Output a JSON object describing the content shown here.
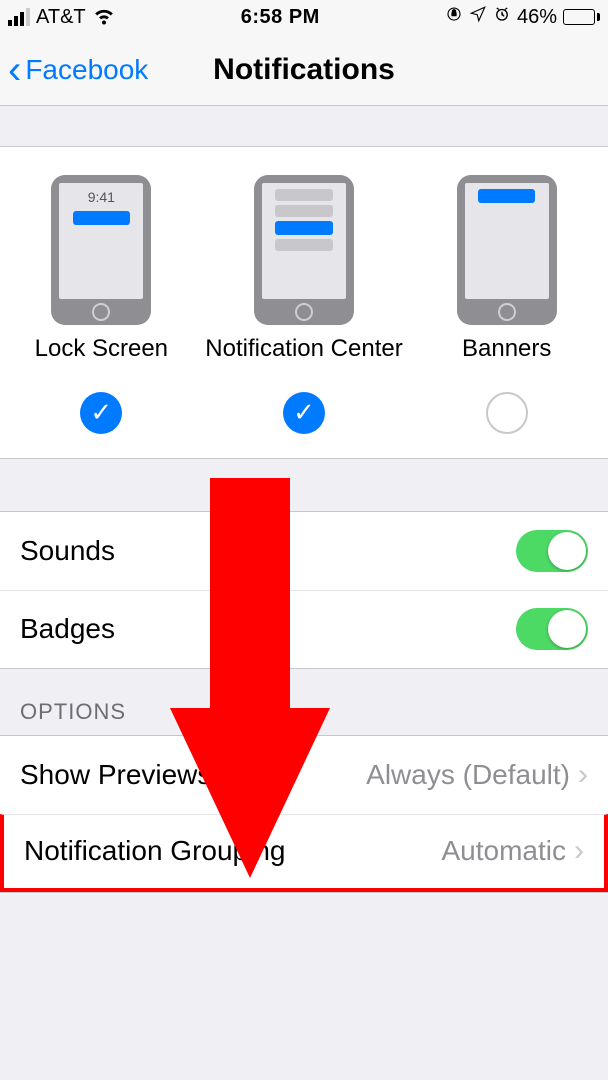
{
  "status": {
    "carrier": "AT&T",
    "time": "6:58 PM",
    "battery_pct": "46%"
  },
  "nav": {
    "back_label": "Facebook",
    "title": "Notifications"
  },
  "alerts": {
    "mock_time": "9:41",
    "items": [
      {
        "label": "Lock Screen",
        "checked": true
      },
      {
        "label": "Notification Center",
        "checked": true
      },
      {
        "label": "Banners",
        "checked": false
      }
    ]
  },
  "toggles": {
    "sounds_label": "Sounds",
    "badges_label": "Badges",
    "sounds_on": true,
    "badges_on": true
  },
  "options": {
    "header": "Options",
    "show_previews_label": "Show Previews",
    "show_previews_value": "Always (Default)",
    "grouping_label": "Notification Grouping",
    "grouping_value": "Automatic"
  },
  "colors": {
    "accent": "#007aff",
    "toggle_on": "#4cd964",
    "battery_low": "#ffcc00",
    "highlight": "#ff0000"
  }
}
